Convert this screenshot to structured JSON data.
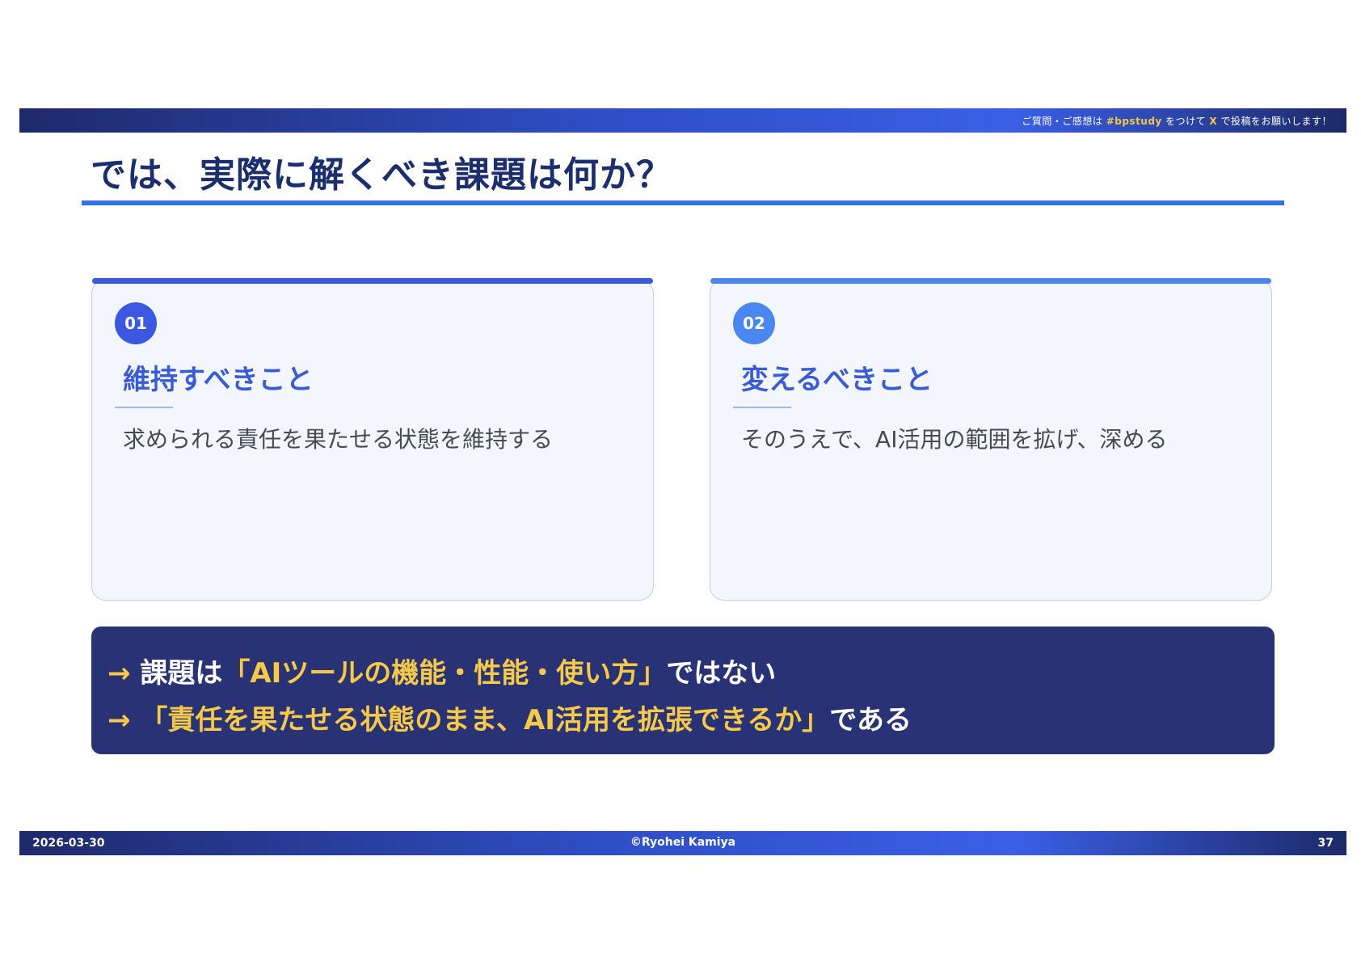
{
  "header": {
    "notice_prefix": "ご質問・ご感想は ",
    "notice_hashtag": "#bpstudy",
    "notice_mid": " をつけて ",
    "notice_x": "X",
    "notice_suffix": " で投稿をお願いします！"
  },
  "title": "では、実際に解くべき課題は何か？",
  "cards": [
    {
      "number": "01",
      "heading": "維持すべきこと",
      "body": "求められる責任を果たせる状態を維持する",
      "accent_color": "#3a58e0"
    },
    {
      "number": "02",
      "heading": "変えるべきこと",
      "body": "そのうえで、AI活用の範囲を拡げ、深める",
      "accent_color": "#4a88ef"
    }
  ],
  "conclusion": {
    "line1": {
      "arrow": "→",
      "prefix": " 課題は",
      "quote": "「AIツールの機能・性能・使い方」",
      "suffix": "ではない"
    },
    "line2": {
      "arrow": "→",
      "prefix": " ",
      "quote": "「責任を果たせる状態のまま、AI活用を拡張できるか」",
      "suffix": "である"
    }
  },
  "footer": {
    "date": "2026-03-30",
    "copyright": "©Ryohei Kamiya",
    "page": "37"
  },
  "colors": {
    "title": "#1b2f6e",
    "accent_blue": "#2f74e0",
    "highlight": "#f7c948",
    "conclusion_bg": "#283274"
  }
}
